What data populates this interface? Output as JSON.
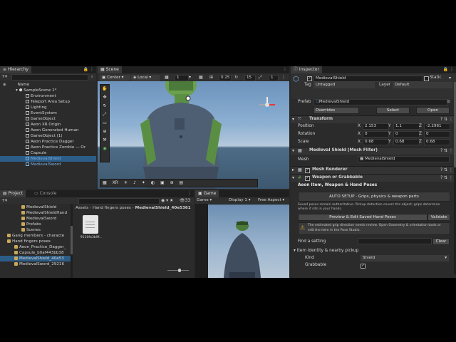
{
  "hierarchy": {
    "tab": "Hierarchy",
    "root": "Name",
    "scene": "SampleScene 1*",
    "items": [
      {
        "label": "Environment",
        "prefab": false
      },
      {
        "label": "Teleport Area Setup",
        "prefab": false
      },
      {
        "label": "Lighting",
        "prefab": false
      },
      {
        "label": "EventSystem",
        "prefab": false
      },
      {
        "label": "GameObject",
        "prefab": false
      },
      {
        "label": "Aeon XR Origin",
        "prefab": false
      },
      {
        "label": "Aeon Generated Human",
        "prefab": false
      },
      {
        "label": "GameObject (1)",
        "prefab": false
      },
      {
        "label": "Aeon Practice Dagger",
        "prefab": false
      },
      {
        "label": "Aeon Practice Zombie — Or",
        "prefab": false
      },
      {
        "label": "Capsule",
        "prefab": false
      },
      {
        "label": "MedievalShield",
        "prefab": true
      },
      {
        "label": "MedievalSword",
        "prefab": true
      }
    ]
  },
  "scene": {
    "tab": "Scene",
    "pivot": "Center",
    "space": "Local",
    "snap": "1",
    "grid": "0.25",
    "angle": "15",
    "scale": "1"
  },
  "inspector": {
    "tab": "Inspector",
    "object_name": "MedievalShield",
    "static_label": "Static",
    "tag_label": "Tag",
    "tag_value": "Untagged",
    "layer_label": "Layer",
    "layer_value": "Default",
    "prefab_label": "Prefab",
    "prefab_value": "MedievalShield",
    "overrides": "Overrides",
    "select": "Select",
    "open": "Open",
    "transform": {
      "title": "Transform",
      "rows": [
        {
          "label": "Position",
          "x": "2.153",
          "y": "1.1",
          "z": "-2.2961"
        },
        {
          "label": "Rotation",
          "x": "0",
          "y": "0",
          "z": "0"
        },
        {
          "label": "Scale",
          "x": "0.68",
          "y": "0.68",
          "z": "0.68"
        }
      ]
    },
    "mesh_filter": {
      "title": "Medieval Shield (Mesh Filter)",
      "mesh_label": "Mesh",
      "mesh_value": "MedievalShield"
    },
    "mesh_renderer": {
      "title": "Mesh Renderer"
    },
    "weapon": {
      "title": "Weapon or Grabbable",
      "subtitle": "Aeon Item, Weapon & Hand Poses",
      "auto_setup": "AUTO SETUP · Grips, physics & weapon parts",
      "note": "Saved poses remain authoritative. Pickup detection covers the object; grips determine where it sits in your hands.",
      "preview_button": "Preview & Edit Saved Hand Poses",
      "validate_button": "Validate",
      "warning": "The estimated grip direction needs review. Open Geometry & orientation tools or edit the item in the Pose Studio.",
      "find_label": "Find a setting",
      "clear": "Clear",
      "identity_title": "Item identity & nearby pickup",
      "kind_label": "Kind",
      "kind_value": "Shield",
      "grabbable_label": "Grabbable"
    }
  },
  "project": {
    "tabs": [
      "Project",
      "Console"
    ],
    "count": "33",
    "tree": [
      {
        "label": "MedievalShield",
        "indent": 2
      },
      {
        "label": "MedievalShieldHand",
        "indent": 2
      },
      {
        "label": "MedievalSword",
        "indent": 2
      },
      {
        "label": "Prefabs",
        "indent": 2
      },
      {
        "label": "Scenes",
        "indent": 2
      },
      {
        "label": "Gang members - characte",
        "indent": 0
      },
      {
        "label": "Hand fingers poses",
        "indent": 0
      },
      {
        "label": "Aeon_Practice_Dagger_",
        "indent": 1
      },
      {
        "label": "Capsule_b0af443bb38",
        "indent": 1
      },
      {
        "label": "MedievalShield_40e53",
        "indent": 1
      },
      {
        "label": "MedievalSword_29216",
        "indent": 1
      }
    ],
    "breadcrumb": [
      "Assets",
      "Hand fingers poses",
      "MedievalShield_40e5361"
    ],
    "file_label": "9110fa3b9f..."
  },
  "game": {
    "tab": "Game",
    "display_mode": "Game",
    "display": "Display 1",
    "aspect": "Free Aspect"
  },
  "colors": {
    "selection": "#2c5d87",
    "prefab_blue": "#7fb2e6",
    "panel": "#2b2b2b",
    "accent_green": "#5aa84a"
  }
}
